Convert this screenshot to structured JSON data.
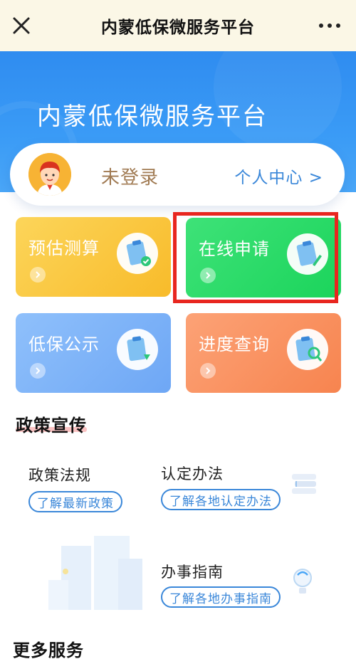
{
  "navbar": {
    "title": "内蒙低保微服务平台",
    "close_icon": "close-icon",
    "more_icon": "more-icon"
  },
  "hero": {
    "title": "内蒙低保微服务平台"
  },
  "user": {
    "status": "未登录",
    "personal_center": "个人中心 >"
  },
  "tiles": [
    {
      "label": "预估测算",
      "icon": "clipboard-check-icon",
      "color": "#f8bb2a"
    },
    {
      "label": "在线申请",
      "icon": "clipboard-pen-icon",
      "color": "#1bd45b"
    },
    {
      "label": "低保公示",
      "icon": "clipboard-pin-icon",
      "color": "#6ea7f5"
    },
    {
      "label": "进度查询",
      "icon": "clipboard-search-icon",
      "color": "#f7844f"
    }
  ],
  "policy": {
    "heading": "政策宣传",
    "items": [
      {
        "title": "政策法规",
        "link": "了解最新政策"
      },
      {
        "title": "认定办法",
        "link": "了解各地认定办法"
      },
      {
        "title": "办事指南",
        "link": "了解各地办事指南"
      }
    ]
  },
  "more": {
    "heading": "更多服务"
  },
  "colors": {
    "accent": "#3a87d9",
    "highlight": "#e8261f"
  }
}
